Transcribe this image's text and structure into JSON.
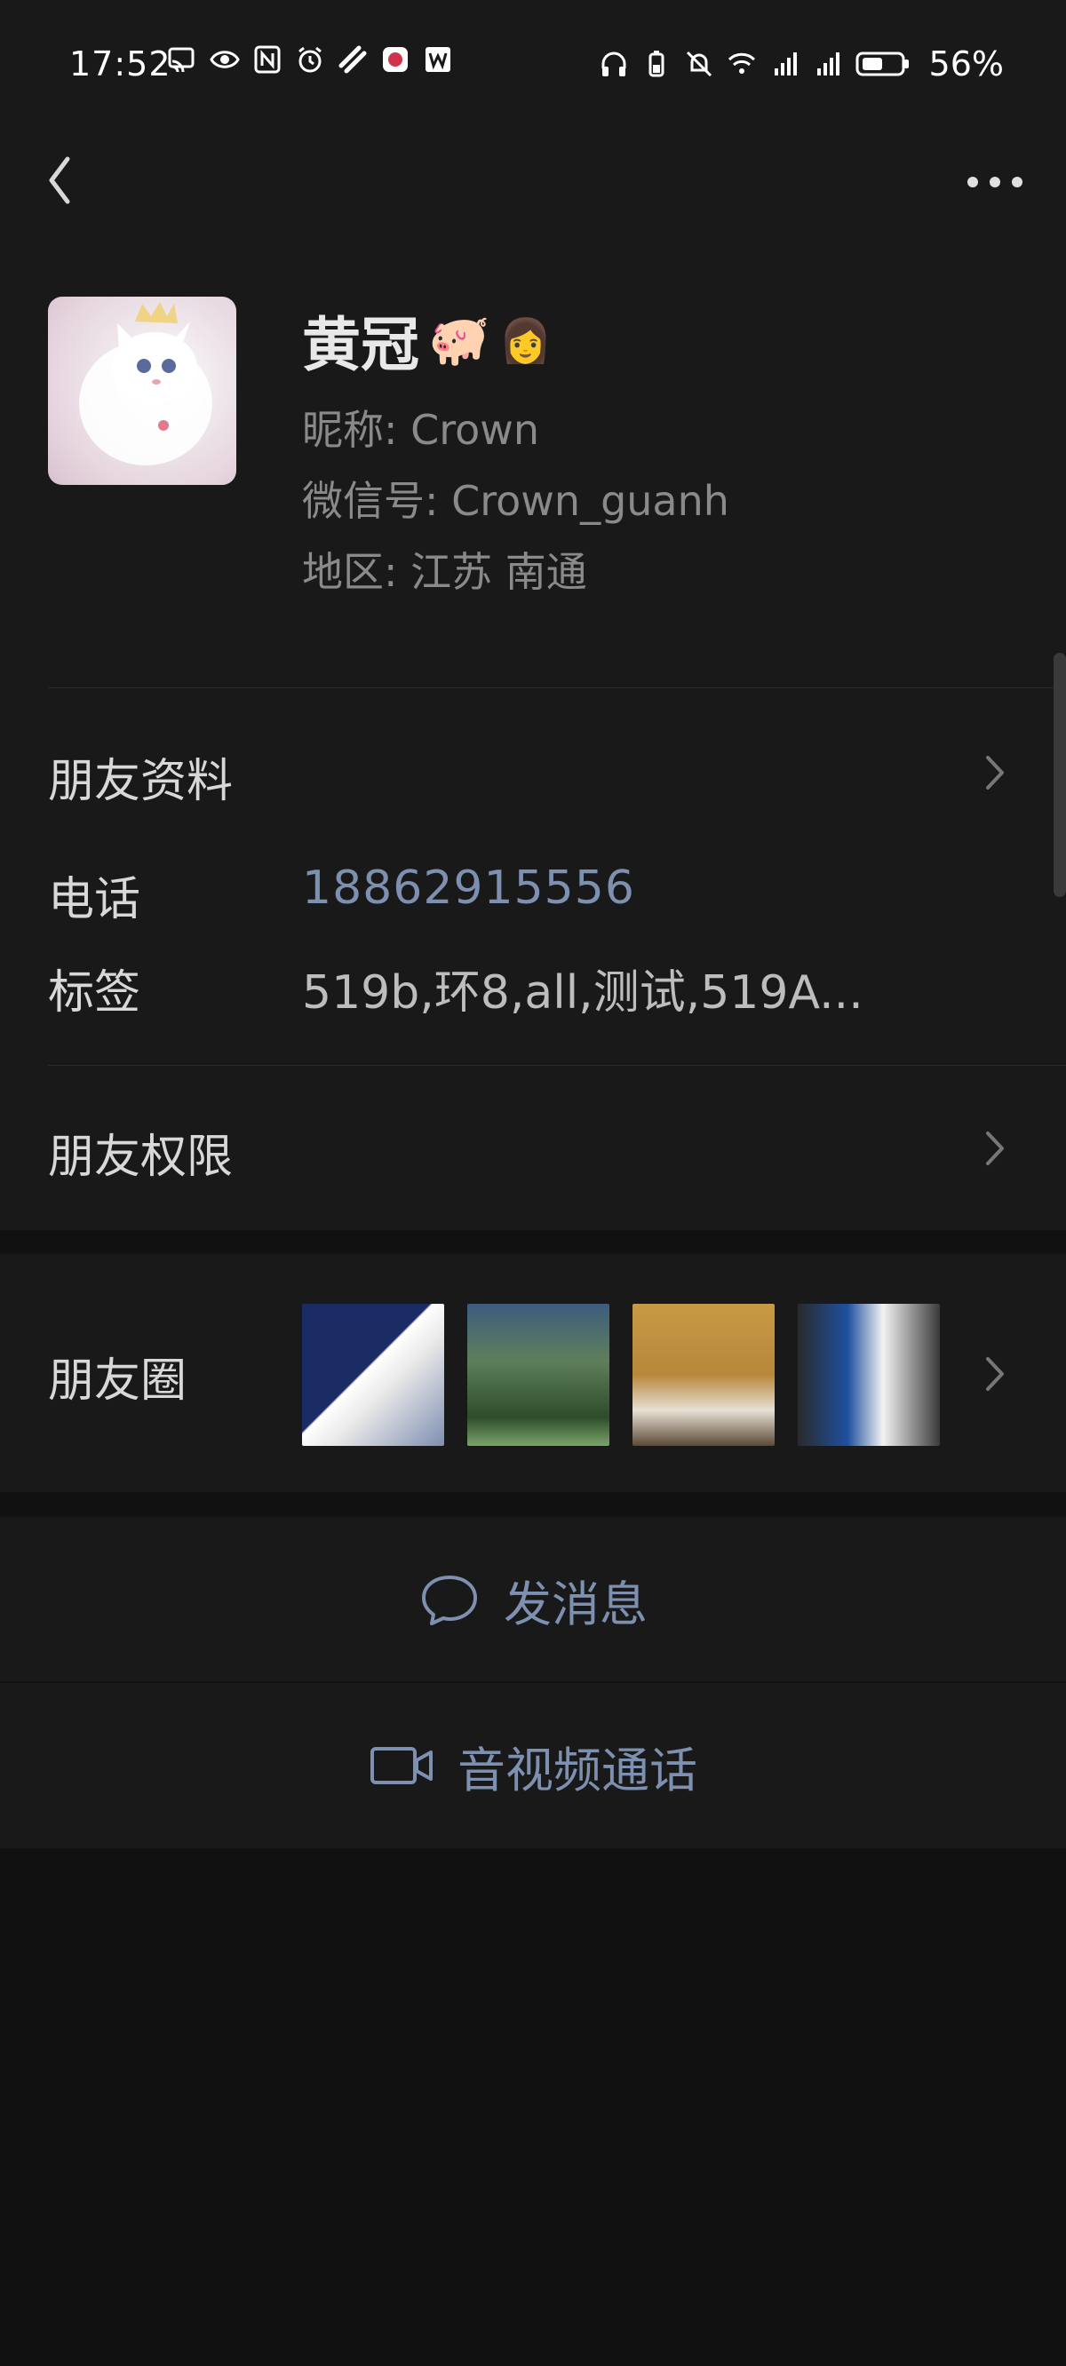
{
  "status_bar": {
    "time": "17:52",
    "battery_percent": "56%",
    "icons_left": [
      "cast-icon",
      "eye-icon",
      "nfc-icon",
      "alarm-icon",
      "cut-icon",
      "app-icon",
      "w-icon"
    ],
    "icons_right": [
      "headphones-icon",
      "battery-small-icon",
      "mute-icon",
      "wifi-icon",
      "signal-5g-icon",
      "signal-5g-icon",
      "battery-icon"
    ]
  },
  "profile": {
    "name": "黄冠",
    "name_emojis": [
      "🐖",
      "👩"
    ],
    "nickname_label": "昵称:",
    "nickname": "Crown",
    "wechat_label": "微信号:",
    "wechat_id": "Crown_guanh",
    "region_label": "地区:",
    "region": "江苏  南通"
  },
  "sections": {
    "friend_profile": "朋友资料",
    "phone_label": "电话",
    "phone_value": "18862915556",
    "tags_label": "标签",
    "tags_value": "519b,环8,all,测试,519A...",
    "permissions": "朋友权限",
    "moments": "朋友圈"
  },
  "actions": {
    "message": "发消息",
    "call": "音视频通话"
  },
  "colors": {
    "bg": "#111111",
    "panel": "#191919",
    "link": "#7d90b0",
    "text": "#d8d8d8",
    "muted": "#8a8a8a"
  }
}
